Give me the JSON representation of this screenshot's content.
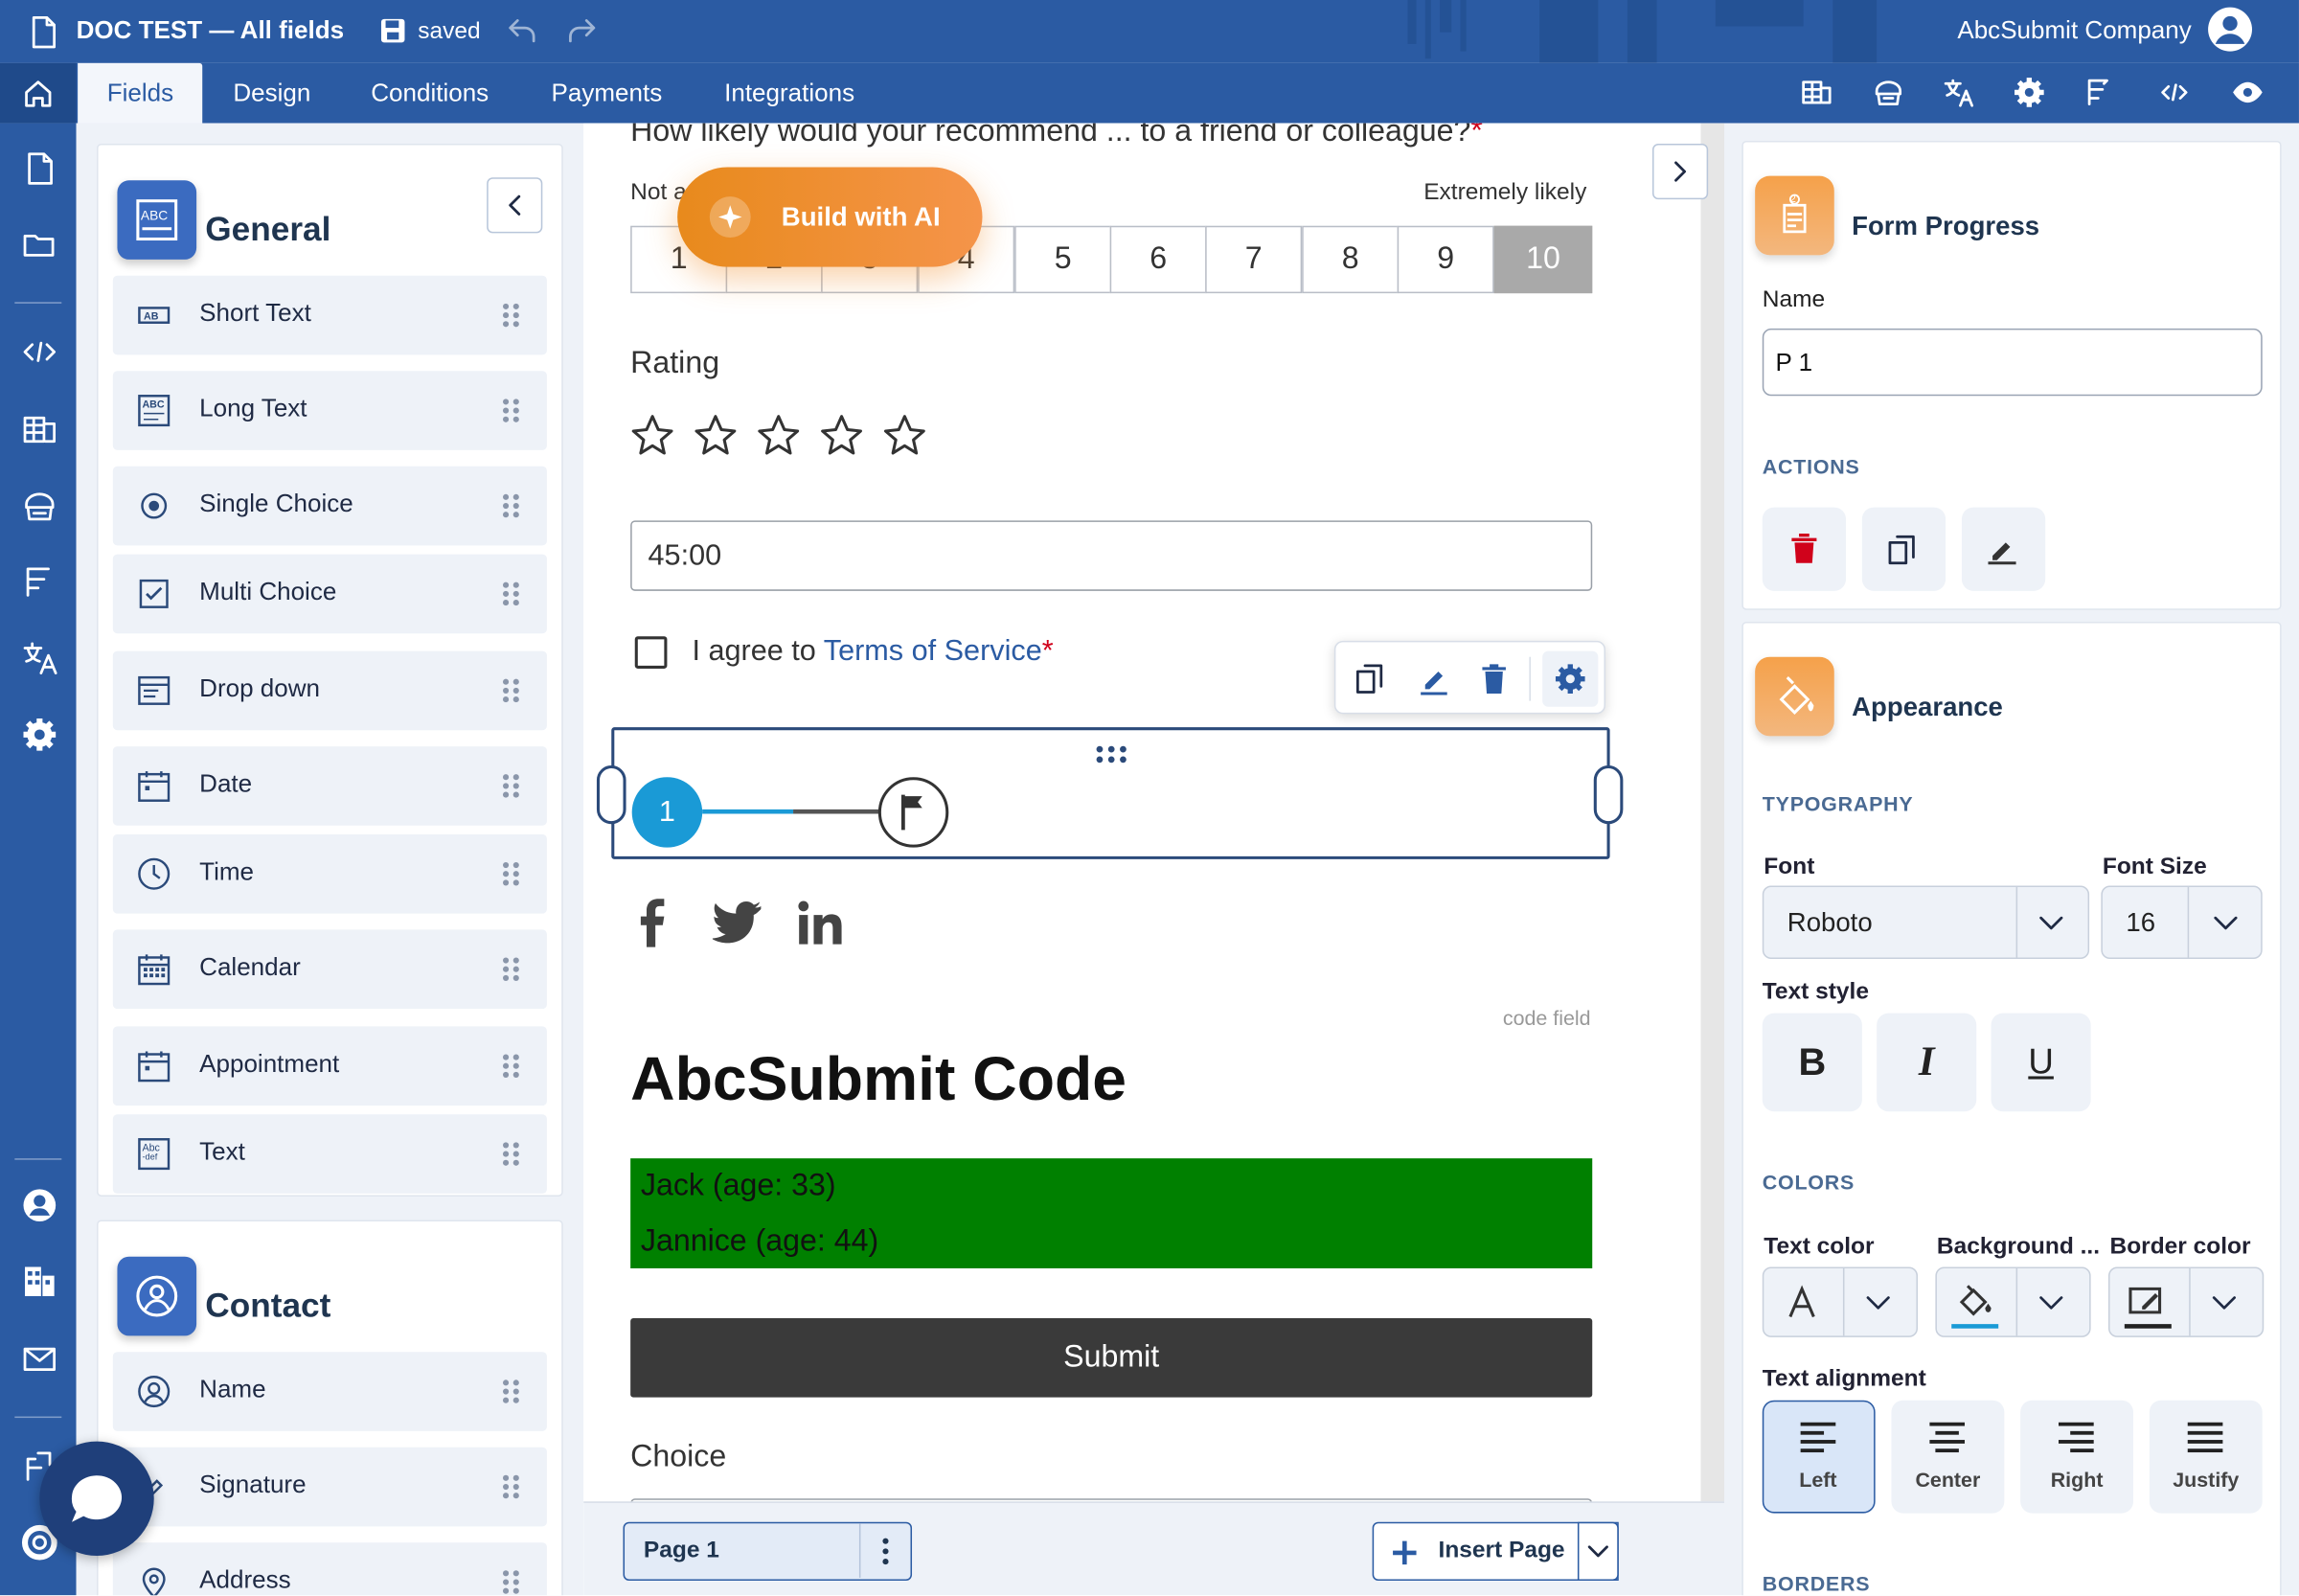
{
  "app": {
    "title": "DOC TEST — All fields",
    "save_status": "saved",
    "company": "AbcSubmit Company"
  },
  "tabs": [
    {
      "label": "Fields",
      "active": true
    },
    {
      "label": "Design"
    },
    {
      "label": "Conditions"
    },
    {
      "label": "Payments"
    },
    {
      "label": "Integrations"
    }
  ],
  "fields_panel": {
    "general": {
      "title": "General",
      "items": [
        {
          "label": "Short Text",
          "icon": "short-text-icon"
        },
        {
          "label": "Long Text",
          "icon": "long-text-icon"
        },
        {
          "label": "Single Choice",
          "icon": "radio-icon"
        },
        {
          "label": "Multi Choice",
          "icon": "checkbox-icon"
        },
        {
          "label": "Drop down",
          "icon": "dropdown-icon"
        },
        {
          "label": "Date",
          "icon": "date-icon"
        },
        {
          "label": "Time",
          "icon": "clock-icon"
        },
        {
          "label": "Calendar",
          "icon": "calendar-icon"
        },
        {
          "label": "Appointment",
          "icon": "appointment-icon"
        },
        {
          "label": "Text",
          "icon": "text-icon"
        }
      ]
    },
    "contact": {
      "title": "Contact",
      "items": [
        {
          "label": "Name",
          "icon": "person-icon"
        },
        {
          "label": "Signature",
          "icon": "signature-icon"
        },
        {
          "label": "Address",
          "icon": "location-icon"
        }
      ]
    }
  },
  "form": {
    "nps": {
      "question": "How likely would your recommend ... to a friend or colleague?",
      "required_mark": "*",
      "left_label": "Not a",
      "right_label": "Extremely likely",
      "options": [
        "1",
        "2",
        "3",
        "4",
        "5",
        "6",
        "7",
        "8",
        "9",
        "10"
      ],
      "selected": "10"
    },
    "build_ai_label": "Build with AI",
    "rating": {
      "label": "Rating",
      "stars": 5
    },
    "time_value": "45:00",
    "terms": {
      "prefix": "I agree to",
      "link": "Terms of Service",
      "required_mark": "*"
    },
    "progress": {
      "step": "1"
    },
    "code_field_caption": "code field",
    "code_heading": "AbcSubmit Code",
    "code_rows": [
      "Jack (age: 33)",
      "Jannice (age: 44)"
    ],
    "code_bg": "#008000",
    "submit_label": "Submit",
    "choice_label": "Choice"
  },
  "footer": {
    "page_label": "Page 1",
    "insert_page_label": "Insert Page"
  },
  "right_panel": {
    "form_progress": {
      "title": "Form Progress",
      "name_label": "Name",
      "name_value": "P 1",
      "actions_label": "ACTIONS"
    },
    "appearance": {
      "title": "Appearance",
      "typography_label": "TYPOGRAPHY",
      "font_label": "Font",
      "font_value": "Roboto",
      "font_size_label": "Font Size",
      "font_size_value": "16",
      "text_style_label": "Text style",
      "bold": "B",
      "italic": "I",
      "underline": "U",
      "colors_label": "COLORS",
      "text_color_label": "Text color",
      "background_label": "Background ...",
      "border_color_label": "Border color",
      "alignment_label": "Text alignment",
      "alignments": [
        "Left",
        "Center",
        "Right",
        "Justify"
      ],
      "alignment_selected": "Left",
      "borders_label": "BORDERS"
    }
  },
  "colors": {
    "brand": "#2b5ba3",
    "accent_orange": "#f08a24",
    "progress_blue": "#1a9ad6",
    "delete_red": "#d0021b",
    "dark_button": "#3a3a3a"
  }
}
